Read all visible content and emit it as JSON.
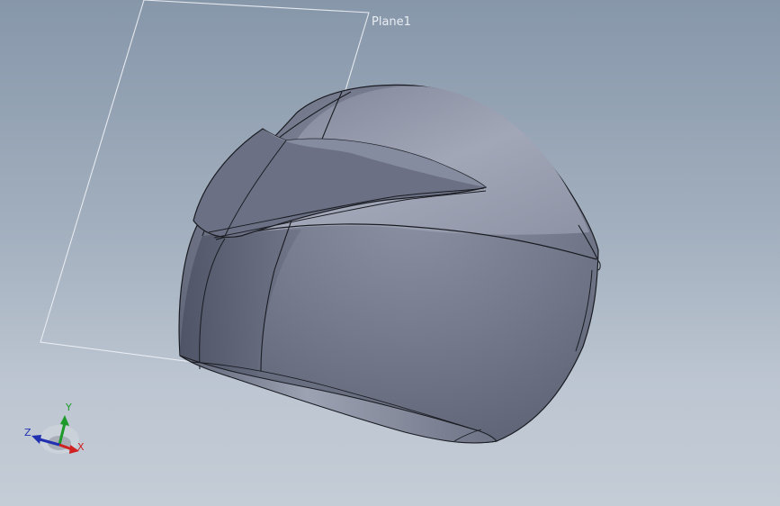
{
  "viewport": {
    "plane_label": "Plane1",
    "model": "helmet-solid-body"
  },
  "triad": {
    "x_label": "X",
    "y_label": "Y",
    "z_label": "Z",
    "x_color": "#d02020",
    "y_color": "#1e9a2a",
    "z_color": "#2030b0"
  },
  "colors": {
    "background_top": "#8797aa",
    "background_bottom": "#c4ccd6",
    "model_shade": "#6e7386",
    "edge": "#1a1c22",
    "plane_outline": "#eef1f5"
  }
}
